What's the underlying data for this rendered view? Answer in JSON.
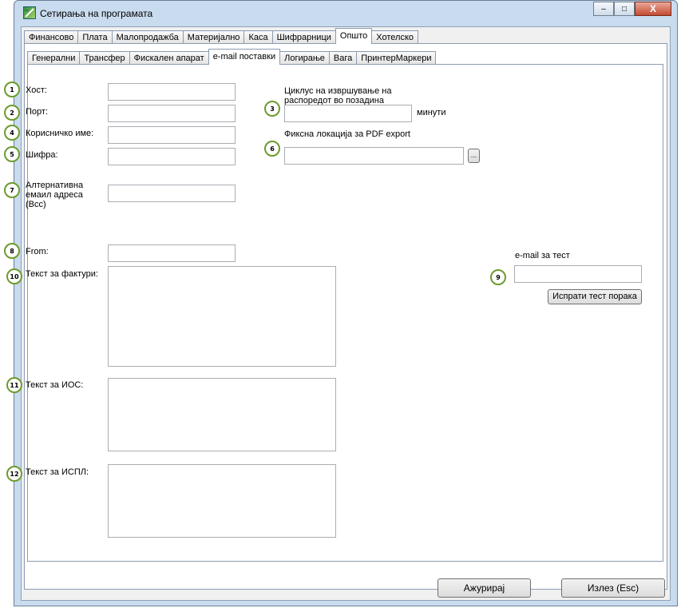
{
  "window": {
    "title": "Сетирања на програмата",
    "controls": {
      "minimize": "‒",
      "maximize": "□",
      "close": "X"
    }
  },
  "main_tabs": [
    "Финансово",
    "Плата",
    "Малопродажба",
    "Материјално",
    "Каса",
    "Шифрарници",
    "Општо",
    "Хотелско"
  ],
  "sub_tabs": [
    "Генерални",
    "Трансфер",
    "Фискален апарат",
    "e-mail поставки",
    "Логирање",
    "Вага",
    "ПринтерМаркери"
  ],
  "form": {
    "host_label": "Хост:",
    "port_label": "Порт:",
    "username_label": "Корисничко име:",
    "password_label": "Шифра:",
    "alt_email_label_1": "Алтернативна",
    "alt_email_label_2": "емаил адреса",
    "alt_email_label_3": "(Bcc)",
    "from_label": "From:",
    "invoice_text_label": "Текст за фактури:",
    "ios_text_label": "Текст за ИОС:",
    "ispl_text_label": "Текст за ИСПЛ:",
    "cycle_label_1": "Циклус на извршување на",
    "cycle_label_2": "распоредот во позадина",
    "minutes_label": "минути",
    "pdf_location_label": "Фиксна локација за PDF export",
    "browse_button": "...",
    "test_email_label": "e-mail за тест",
    "send_test_button": "Испрати тест порака"
  },
  "badges": [
    "1",
    "2",
    "3",
    "4",
    "5",
    "6",
    "7",
    "8",
    "9",
    "10",
    "11",
    "12"
  ],
  "footer": {
    "update_button": "Ажурирај",
    "exit_button": "Излез (Esc)"
  },
  "colors": {
    "window_frame": "#c9dbee",
    "badge_border": "#6d9b2e"
  }
}
